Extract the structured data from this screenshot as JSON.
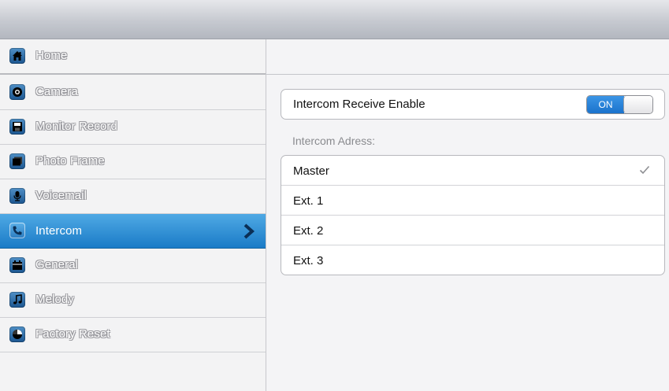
{
  "sidebar": {
    "items": [
      {
        "label": "Home",
        "icon": "home-icon"
      },
      {
        "label": "Camera",
        "icon": "camera-icon"
      },
      {
        "label": "Monitor Record",
        "icon": "save-icon"
      },
      {
        "label": "Photo Frame",
        "icon": "photo-frame-icon"
      },
      {
        "label": "Voicemail",
        "icon": "microphone-icon"
      },
      {
        "label": "Intercom",
        "icon": "phone-icon",
        "selected": true
      },
      {
        "label": "General",
        "icon": "calendar-icon"
      },
      {
        "label": "Melody",
        "icon": "music-note-icon"
      },
      {
        "label": "Factory Reset",
        "icon": "reset-icon"
      }
    ]
  },
  "main": {
    "receive_enable": {
      "label": "Intercom Receive Enable",
      "toggle_label": "ON",
      "enabled": true
    },
    "address_section_label": "Intercom Adress:",
    "addresses": [
      {
        "label": "Master",
        "selected": true
      },
      {
        "label": "Ext. 1",
        "selected": false
      },
      {
        "label": "Ext. 2",
        "selected": false
      },
      {
        "label": "Ext. 3",
        "selected": false
      }
    ]
  },
  "colors": {
    "accent": "#1a7bc7",
    "toggle_on": "#2585d8"
  }
}
